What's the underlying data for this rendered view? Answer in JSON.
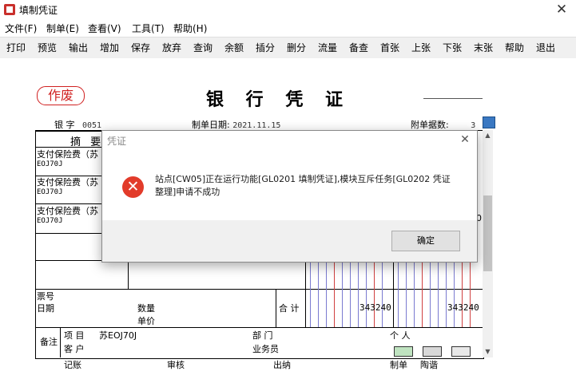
{
  "window": {
    "title": "填制凭证",
    "close_glyph": "✕"
  },
  "menu": [
    "文件(F)",
    "制单(E)",
    "查看(V)",
    "工具(T)",
    "帮助(H)"
  ],
  "toolbar": [
    "打印",
    "预览",
    "输出",
    "增加",
    "保存",
    "放弃",
    "查询",
    "余额",
    "插分",
    "删分",
    "流量",
    "备查",
    "首张",
    "上张",
    "下张",
    "末张",
    "帮助",
    "退出"
  ],
  "voucher": {
    "void_stamp": "作废",
    "title": "银 行 凭 证",
    "type_label": "银  字",
    "number": "0051",
    "date_label": "制单日期:",
    "date": "2021.11.15",
    "attachments_label": "附单据数:",
    "attachments": "3",
    "summary_header": "摘 要",
    "rows": [
      {
        "summary": "支付保险费（苏",
        "code": "EOJ70J"
      },
      {
        "summary": "支付保险费（苏",
        "code": "EOJ70J"
      },
      {
        "summary": "支付保险费（苏",
        "code": "EOJ70J"
      }
    ],
    "row3_fragment": "0",
    "ticket_no_label": "票号",
    "date_row_label": "日期",
    "quantity_label": "数量",
    "unit_price_label": "单价",
    "total_label": "合 计",
    "debit_total": "343240",
    "credit_total": "343240",
    "remarks_label": "备注",
    "project_label": "项  目",
    "project_value": "苏EOJ70J",
    "department_label": "部  门",
    "person_label": "个  人",
    "customer_label": "客  户",
    "salesperson_label": "业务员",
    "footer": {
      "bookkeeper": "记账",
      "reviewer": "审核",
      "cashier": "出纳",
      "maker_label": "制单",
      "maker": "陶谐"
    }
  },
  "dialog": {
    "title": "凭证",
    "close_glyph": "✕",
    "icon": "error-icon",
    "message": "站点[CW05]正在运行功能[GL0201 填制凭证],模块互斥任务[GL0202 凭证整理]申请不成功",
    "ok_label": "确定"
  },
  "colors": {
    "void_red": "#d02020",
    "error_red": "#e23b2a",
    "grid_blue": "#7a7ad0"
  }
}
